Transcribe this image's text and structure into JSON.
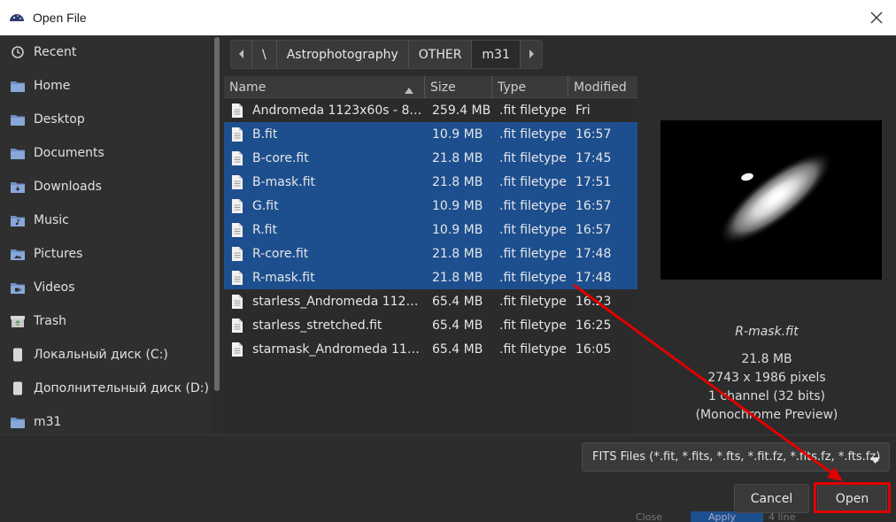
{
  "window": {
    "title": "Open File"
  },
  "sidebar": {
    "items": [
      {
        "label": "Recent",
        "icon": "clock-icon"
      },
      {
        "label": "Home",
        "icon": "folder-icon"
      },
      {
        "label": "Desktop",
        "icon": "folder-icon"
      },
      {
        "label": "Documents",
        "icon": "folder-icon"
      },
      {
        "label": "Downloads",
        "icon": "folder-download-icon"
      },
      {
        "label": "Music",
        "icon": "folder-music-icon"
      },
      {
        "label": "Pictures",
        "icon": "folder-pictures-icon"
      },
      {
        "label": "Videos",
        "icon": "folder-videos-icon"
      },
      {
        "label": "Trash",
        "icon": "trash-icon"
      },
      {
        "label": "Локальный диск (C:)",
        "icon": "drive-icon"
      },
      {
        "label": "Дополнительный диск (D:)",
        "icon": "drive-icon"
      },
      {
        "label": "m31",
        "icon": "folder-icon"
      }
    ]
  },
  "pathbar": {
    "crumbs": [
      "\\",
      "Astrophotography",
      "OTHER",
      "m31"
    ],
    "active": "m31"
  },
  "file_list": {
    "columns": [
      "Name",
      "Size",
      "Type",
      "Modified"
    ],
    "sort_column": "Name",
    "rows": [
      {
        "name": "Andromeda 1123x60s - 80...",
        "size": "259.4 MB",
        "type": ".fit filetype",
        "modified": "Fri",
        "selected": false
      },
      {
        "name": "B.fit",
        "size": "10.9 MB",
        "type": ".fit filetype",
        "modified": "16:57",
        "selected": true
      },
      {
        "name": "B-core.fit",
        "size": "21.8 MB",
        "type": ".fit filetype",
        "modified": "17:45",
        "selected": true
      },
      {
        "name": "B-mask.fit",
        "size": "21.8 MB",
        "type": ".fit filetype",
        "modified": "17:51",
        "selected": true
      },
      {
        "name": "G.fit",
        "size": "10.9 MB",
        "type": ".fit filetype",
        "modified": "16:57",
        "selected": true
      },
      {
        "name": "R.fit",
        "size": "10.9 MB",
        "type": ".fit filetype",
        "modified": "16:57",
        "selected": true
      },
      {
        "name": "R-core.fit",
        "size": "21.8 MB",
        "type": ".fit filetype",
        "modified": "17:48",
        "selected": true
      },
      {
        "name": "R-mask.fit",
        "size": "21.8 MB",
        "type": ".fit filetype",
        "modified": "17:48",
        "selected": true
      },
      {
        "name": "starless_Andromeda 1123x...",
        "size": "65.4 MB",
        "type": ".fit filetype",
        "modified": "16:23",
        "selected": false
      },
      {
        "name": "starless_stretched.fit",
        "size": "65.4 MB",
        "type": ".fit filetype",
        "modified": "16:25",
        "selected": false
      },
      {
        "name": "starmask_Andromeda 1123...",
        "size": "65.4 MB",
        "type": ".fit filetype",
        "modified": "16:05",
        "selected": false
      }
    ]
  },
  "preview": {
    "filename": "R-mask.fit",
    "size": "21.8 MB",
    "dimensions": "2743 x 1986 pixels",
    "channels": "1 channel (32 bits)",
    "mode": "(Monochrome Preview)"
  },
  "filter": {
    "value": "FITS Files (*.fit, *.fits, *.fts, *.fit.fz, *.fits.fz, *.fts.fz)"
  },
  "buttons": {
    "cancel": "Cancel",
    "open": "Open"
  },
  "background_window": {
    "text_1": "Close",
    "text_2": "Apply",
    "text_3": "4 line"
  },
  "colors": {
    "selection": "#1d4f8f",
    "annotation": "#e00000",
    "titlebar": "#ffffff"
  }
}
